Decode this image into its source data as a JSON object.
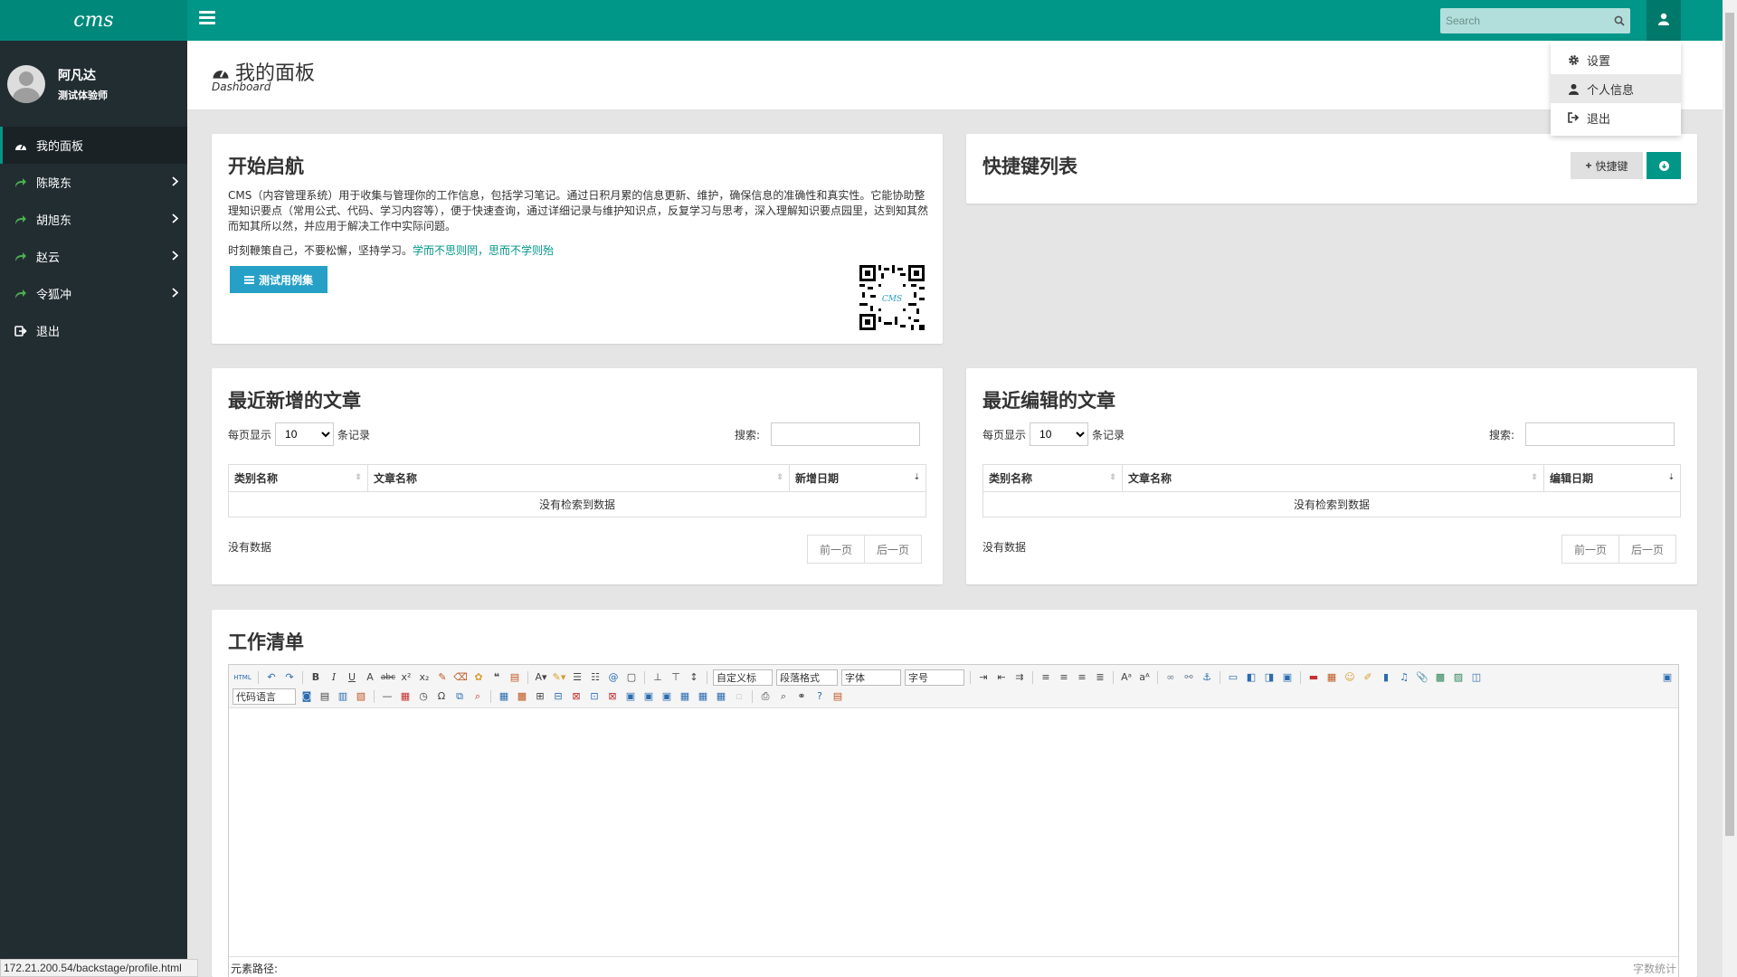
{
  "brand": {
    "logo_text": "cms"
  },
  "topbar": {
    "search_placeholder": "Search"
  },
  "user_menu": {
    "items": [
      {
        "label": "设置",
        "icon": "gear-icon"
      },
      {
        "label": "个人信息",
        "icon": "user-icon"
      },
      {
        "label": "退出",
        "icon": "sign-out-icon"
      }
    ]
  },
  "sidebar": {
    "user_name": "阿凡达",
    "user_role": "测试体验师",
    "items": [
      {
        "label": "我的面板",
        "icon": "dashboard-icon"
      },
      {
        "label": "陈晓东",
        "icon": "share-icon"
      },
      {
        "label": "胡旭东",
        "icon": "share-icon"
      },
      {
        "label": "赵云",
        "icon": "share-icon"
      },
      {
        "label": "令狐冲",
        "icon": "share-icon"
      },
      {
        "label": "退出",
        "icon": "sign-out-icon"
      }
    ]
  },
  "header": {
    "title": "我的面板",
    "subtitle": "Dashboard"
  },
  "start_card": {
    "title": "开始启航",
    "intro": "CMS（内容管理系统）用于收集与管理你的工作信息，包括学习笔记。通过日积月累的信息更新、维护，确保信息的准确性和真实性。它能协助整理知识要点（常用公式、代码、学习内容等），便于快速查询，通过详细记录与维护知识点，反复学习与思考，深入理解知识要点园里，达到知其然而知其所以然，并应用于解决工作中实际问题。",
    "motto_prefix": "时刻鞭策自己，不要松懈，坚持学习。",
    "motto_quote": "学而不思则罔，思而不学则殆",
    "button_label": "测试用例集",
    "qr_label": "CMS"
  },
  "shortcut_card": {
    "title": "快捷键列表",
    "add_label": "快捷键"
  },
  "recent_new": {
    "title": "最近新增的文章",
    "per_page_prefix": "每页显示",
    "per_page_value": "10",
    "per_page_suffix": "条记录",
    "search_label": "搜索:",
    "columns": [
      "类别名称",
      "文章名称",
      "新增日期"
    ],
    "empty_message": "没有检索到数据",
    "info": "没有数据",
    "prev_label": "前一页",
    "next_label": "后一页"
  },
  "recent_edit": {
    "title": "最近编辑的文章",
    "per_page_prefix": "每页显示",
    "per_page_value": "10",
    "per_page_suffix": "条记录",
    "search_label": "搜索:",
    "columns": [
      "类别名称",
      "文章名称",
      "编辑日期"
    ],
    "empty_message": "没有检索到数据",
    "info": "没有数据",
    "prev_label": "前一页",
    "next_label": "后一页"
  },
  "worklist": {
    "title": "工作清单",
    "toolbar": {
      "html_label": "HTML",
      "custom_title": "自定义标",
      "paragraph": "段落格式",
      "font_family": "字体",
      "font_size": "字号",
      "code_lang": "代码语言"
    },
    "element_path": "元素路径:",
    "word_count": "字数统计"
  },
  "status_url": "172.21.200.54/backstage/profile.html",
  "colors": {
    "accent": "#009688",
    "sidebar_bg": "#222d32",
    "button_blue": "#26a0c6"
  }
}
